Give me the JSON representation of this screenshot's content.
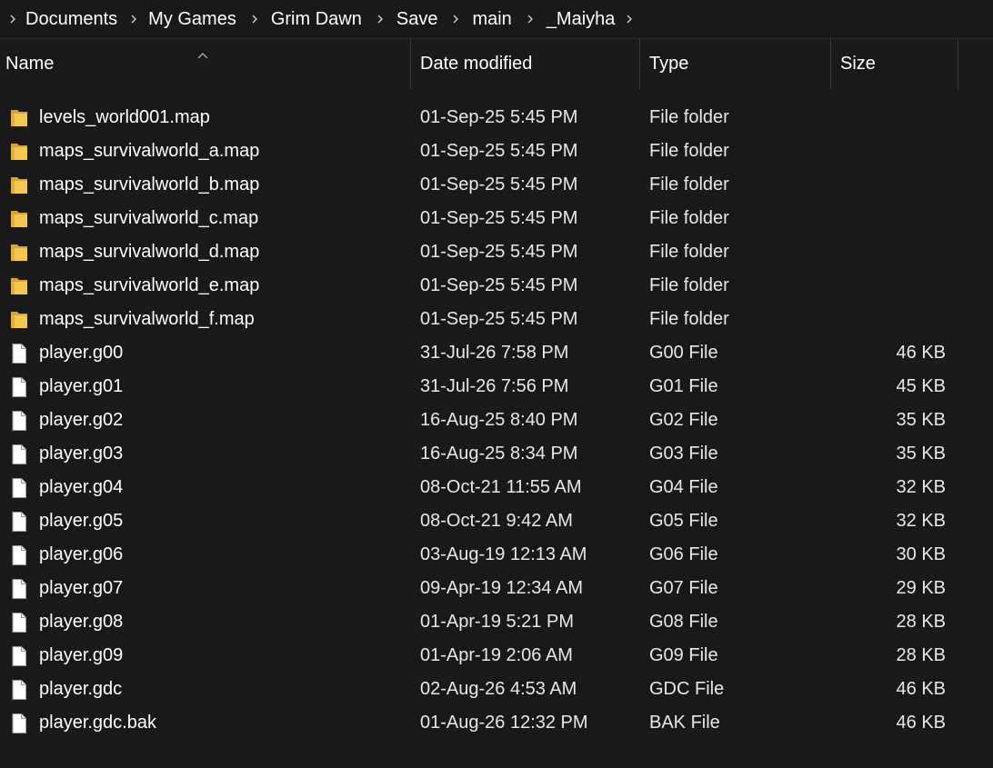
{
  "breadcrumb": [
    {
      "label": "Documents"
    },
    {
      "label": "My Games"
    },
    {
      "label": "Grim Dawn"
    },
    {
      "label": "Save"
    },
    {
      "label": "main"
    },
    {
      "label": "_Maiyha"
    }
  ],
  "columns": {
    "name": "Name",
    "date": "Date modified",
    "type": "Type",
    "size": "Size"
  },
  "files": [
    {
      "icon": "folder-icon",
      "name": "levels_world001.map",
      "date": "01-Sep-25 5:45 PM",
      "type": "File folder",
      "size": ""
    },
    {
      "icon": "folder-icon",
      "name": "maps_survivalworld_a.map",
      "date": "01-Sep-25 5:45 PM",
      "type": "File folder",
      "size": ""
    },
    {
      "icon": "folder-icon",
      "name": "maps_survivalworld_b.map",
      "date": "01-Sep-25 5:45 PM",
      "type": "File folder",
      "size": ""
    },
    {
      "icon": "folder-icon",
      "name": "maps_survivalworld_c.map",
      "date": "01-Sep-25 5:45 PM",
      "type": "File folder",
      "size": ""
    },
    {
      "icon": "folder-icon",
      "name": "maps_survivalworld_d.map",
      "date": "01-Sep-25 5:45 PM",
      "type": "File folder",
      "size": ""
    },
    {
      "icon": "folder-icon",
      "name": "maps_survivalworld_e.map",
      "date": "01-Sep-25 5:45 PM",
      "type": "File folder",
      "size": ""
    },
    {
      "icon": "folder-icon",
      "name": "maps_survivalworld_f.map",
      "date": "01-Sep-25 5:45 PM",
      "type": "File folder",
      "size": ""
    },
    {
      "icon": "file-icon",
      "name": "player.g00",
      "date": "31-Jul-26 7:58 PM",
      "type": "G00 File",
      "size": "46 KB"
    },
    {
      "icon": "file-icon",
      "name": "player.g01",
      "date": "31-Jul-26 7:56 PM",
      "type": "G01 File",
      "size": "45 KB"
    },
    {
      "icon": "file-icon",
      "name": "player.g02",
      "date": "16-Aug-25 8:40 PM",
      "type": "G02 File",
      "size": "35 KB"
    },
    {
      "icon": "file-icon",
      "name": "player.g03",
      "date": "16-Aug-25 8:34 PM",
      "type": "G03 File",
      "size": "35 KB"
    },
    {
      "icon": "file-icon",
      "name": "player.g04",
      "date": "08-Oct-21 11:55 AM",
      "type": "G04 File",
      "size": "32 KB"
    },
    {
      "icon": "file-icon",
      "name": "player.g05",
      "date": "08-Oct-21 9:42 AM",
      "type": "G05 File",
      "size": "32 KB"
    },
    {
      "icon": "file-icon",
      "name": "player.g06",
      "date": "03-Aug-19 12:13 AM",
      "type": "G06 File",
      "size": "30 KB"
    },
    {
      "icon": "file-icon",
      "name": "player.g07",
      "date": "09-Apr-19 12:34 AM",
      "type": "G07 File",
      "size": "29 KB"
    },
    {
      "icon": "file-icon",
      "name": "player.g08",
      "date": "01-Apr-19 5:21 PM",
      "type": "G08 File",
      "size": "28 KB"
    },
    {
      "icon": "file-icon",
      "name": "player.g09",
      "date": "01-Apr-19 2:06 AM",
      "type": "G09 File",
      "size": "28 KB"
    },
    {
      "icon": "file-icon",
      "name": "player.gdc",
      "date": "02-Aug-26 4:53 AM",
      "type": "GDC File",
      "size": "46 KB"
    },
    {
      "icon": "file-icon",
      "name": "player.gdc.bak",
      "date": "01-Aug-26 12:32 PM",
      "type": "BAK File",
      "size": "46 KB"
    }
  ],
  "colors": {
    "background": "#191919",
    "folder": "#f2c14e",
    "text": "#ffffff"
  }
}
